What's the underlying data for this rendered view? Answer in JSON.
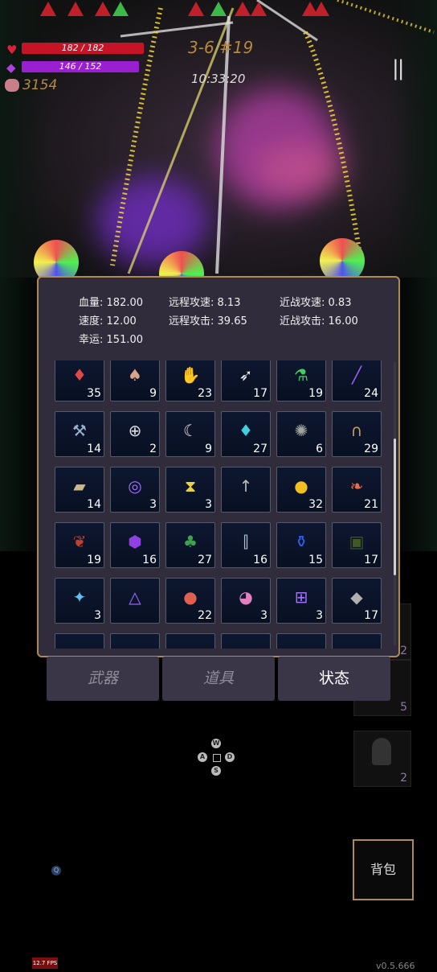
{
  "hud": {
    "hp_text": "182 / 182",
    "mp_text": "146 / 152",
    "gold": "3154",
    "stage": "3-6 #19",
    "timer": "10:33:20",
    "pause_icon": "pause-icon"
  },
  "stats": [
    {
      "label": "血量:",
      "value": "182.00"
    },
    {
      "label": "远程攻速:",
      "value": "8.13"
    },
    {
      "label": "近战攻速:",
      "value": "0.83"
    },
    {
      "label": "速度:",
      "value": "12.00"
    },
    {
      "label": "远程攻击:",
      "value": "39.65"
    },
    {
      "label": "近战攻击:",
      "value": "16.00"
    },
    {
      "label": "幸运:",
      "value": "151.00"
    }
  ],
  "items": [
    {
      "icon": "red-crystal-icon",
      "glyph": "♦",
      "color": "#e04848",
      "count": "35"
    },
    {
      "icon": "mushroom-icon",
      "glyph": "♠",
      "color": "#d9a58a",
      "count": "9"
    },
    {
      "icon": "gloves-icon",
      "glyph": "✋",
      "color": "#b5533a",
      "count": "23"
    },
    {
      "icon": "feather-icon",
      "glyph": "➶",
      "color": "#eeeeee",
      "count": "17"
    },
    {
      "icon": "green-potion-icon",
      "glyph": "⚗",
      "color": "#40d060",
      "count": "19"
    },
    {
      "icon": "purple-wand-icon",
      "glyph": "╱",
      "color": "#a060f0",
      "count": "24"
    },
    {
      "icon": "hammer-icon",
      "glyph": "⚒",
      "color": "#9ab4d0",
      "count": "14"
    },
    {
      "icon": "silver-ring-icon",
      "glyph": "⊕",
      "color": "#dddddd",
      "count": "2"
    },
    {
      "icon": "horn-icon",
      "glyph": "☾",
      "color": "#e8e0d0",
      "count": "9"
    },
    {
      "icon": "blue-crystal-icon",
      "glyph": "♦",
      "color": "#40d0e0",
      "count": "27"
    },
    {
      "icon": "octopus-icon",
      "glyph": "✺",
      "color": "#a0a6a0",
      "count": "6"
    },
    {
      "icon": "horseshoe-icon",
      "glyph": "∩",
      "color": "#c89a50",
      "count": "29"
    },
    {
      "icon": "gauntlet-icon",
      "glyph": "▰",
      "color": "#c8b890",
      "count": "14"
    },
    {
      "icon": "spiral-rune-icon",
      "glyph": "◎",
      "color": "#a070ff",
      "count": "3"
    },
    {
      "icon": "hourglass-card-icon",
      "glyph": "⧗",
      "color": "#e8d040",
      "count": "3"
    },
    {
      "icon": "hook-icon",
      "glyph": "↑",
      "color": "#bbbbbb",
      "count": ""
    },
    {
      "icon": "gold-coin-icon",
      "glyph": "●",
      "color": "#f0c020",
      "count": "32"
    },
    {
      "icon": "fish-pair-icon",
      "glyph": "❧",
      "color": "#e07050",
      "count": "21"
    },
    {
      "icon": "fire-pouch-icon",
      "glyph": "❦",
      "color": "#c04030",
      "count": "19"
    },
    {
      "icon": "purple-gem-icon",
      "glyph": "⬢",
      "color": "#9040e0",
      "count": "16"
    },
    {
      "icon": "clover-icon",
      "glyph": "♣",
      "color": "#40a050",
      "count": "27"
    },
    {
      "icon": "bottle-icon",
      "glyph": "⫿",
      "color": "#b0c0d0",
      "count": "16"
    },
    {
      "icon": "blue-potion-icon",
      "glyph": "⚱",
      "color": "#3060f0",
      "count": "15"
    },
    {
      "icon": "skull-book-icon",
      "glyph": "▣",
      "color": "#405a20",
      "count": "17"
    },
    {
      "icon": "crystal-orb-icon",
      "glyph": "✦",
      "color": "#60c0f0",
      "count": "3"
    },
    {
      "icon": "triangle-rune-icon",
      "glyph": "△",
      "color": "#a070ff",
      "count": ""
    },
    {
      "icon": "apple-icon",
      "glyph": "●",
      "color": "#e06050",
      "count": "22"
    },
    {
      "icon": "pink-slime-icon",
      "glyph": "◕",
      "color": "#e080c0",
      "count": "3"
    },
    {
      "icon": "cross-rune-icon",
      "glyph": "⊞",
      "color": "#a070ff",
      "count": "3"
    },
    {
      "icon": "stone-icon",
      "glyph": "◆",
      "color": "#b0b0b0",
      "count": "17"
    }
  ],
  "tabs": [
    "武器",
    "道具",
    "状态"
  ],
  "side_slots": [
    "2",
    "5",
    "2"
  ],
  "controls": {
    "dpad_keys": [
      "W",
      "A",
      "D",
      "S"
    ],
    "bag_label": "背包",
    "zoom_icon": "Q"
  },
  "footer": {
    "fps": "12.7 FPS",
    "version": "v0.5.666"
  }
}
